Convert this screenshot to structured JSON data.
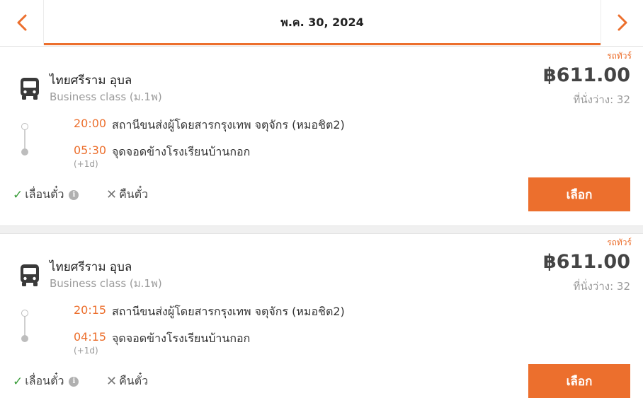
{
  "date_bar": {
    "date": "พ.ค. 30, 2024",
    "prev_icon": "chevron-left-icon",
    "next_icon": "chevron-right-icon"
  },
  "colors": {
    "accent": "#ec6f2d",
    "check": "#3a9d3a",
    "muted": "#9b9b9b"
  },
  "trips": [
    {
      "tag": "รถทัวร์",
      "operator": "ไทยศรีราม อุบล",
      "class": "Business class (ม.1พ)",
      "price": "฿611.00",
      "seats": "ที่นั่งว่าง: 32",
      "departure_time": "20:00",
      "departure_place": "สถานีขนส่งผู้โดยสารกรุงเทพ จตุจักร (หมอชิต2)",
      "arrival_time": "05:30",
      "arrival_place": "จุดจอดข้างโรงเรียนบ้านกอก",
      "day_offset": "(+1d)",
      "reschedule": "เลื่อนตั๋ว",
      "refund": "คืนตั๋ว",
      "select": "เลือก"
    },
    {
      "tag": "รถทัวร์",
      "operator": "ไทยศรีราม อุบล",
      "class": "Business class (ม.1พ)",
      "price": "฿611.00",
      "seats": "ที่นั่งว่าง: 32",
      "departure_time": "20:15",
      "departure_place": "สถานีขนส่งผู้โดยสารกรุงเทพ จตุจักร (หมอชิต2)",
      "arrival_time": "04:15",
      "arrival_place": "จุดจอดข้างโรงเรียนบ้านกอก",
      "day_offset": "(+1d)",
      "reschedule": "เลื่อนตั๋ว",
      "refund": "คืนตั๋ว",
      "select": "เลือก"
    }
  ]
}
